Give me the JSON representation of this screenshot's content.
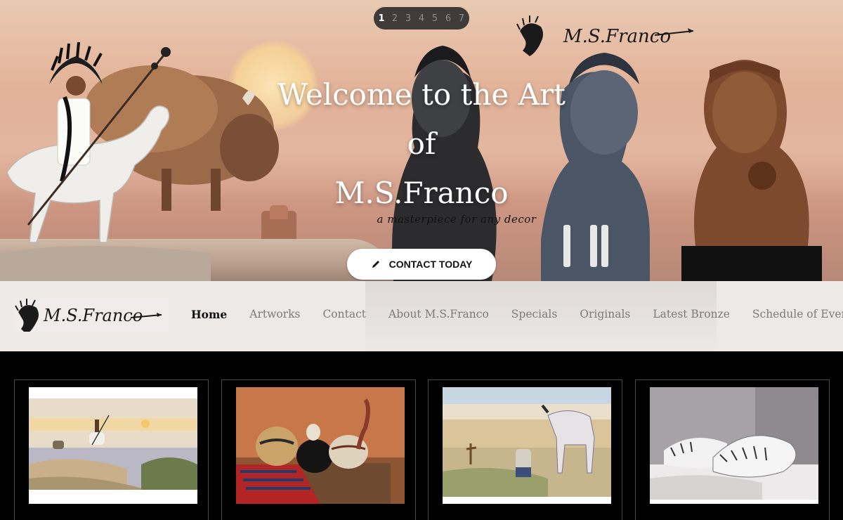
{
  "slider": {
    "pages": [
      "1",
      "2",
      "3",
      "4",
      "5",
      "6",
      "7"
    ],
    "active_page": "1"
  },
  "hero": {
    "title_lines": [
      "Welcome to the Art",
      "of",
      "M.S.Franco"
    ],
    "tagline": "a masterpiece for any decor",
    "cta_label": "CONTACT TODAY",
    "cta_icon": "pencil-icon",
    "signature": "M.S.Franco"
  },
  "logo": {
    "signature": "M.S.Franco"
  },
  "nav": {
    "items": [
      "Home",
      "Artworks",
      "Contact",
      "About M.S.Franco",
      "Specials",
      "Originals",
      "Latest Bronze",
      "Schedule of Events"
    ],
    "active": "Home"
  },
  "gallery": {
    "items": [
      {
        "subject": "Native rider on cliff at sunset"
      },
      {
        "subject": "Pueblo pottery still life"
      },
      {
        "subject": "Cowboy kneeling at grave with horse"
      },
      {
        "subject": "White tigers in snow"
      }
    ]
  }
}
